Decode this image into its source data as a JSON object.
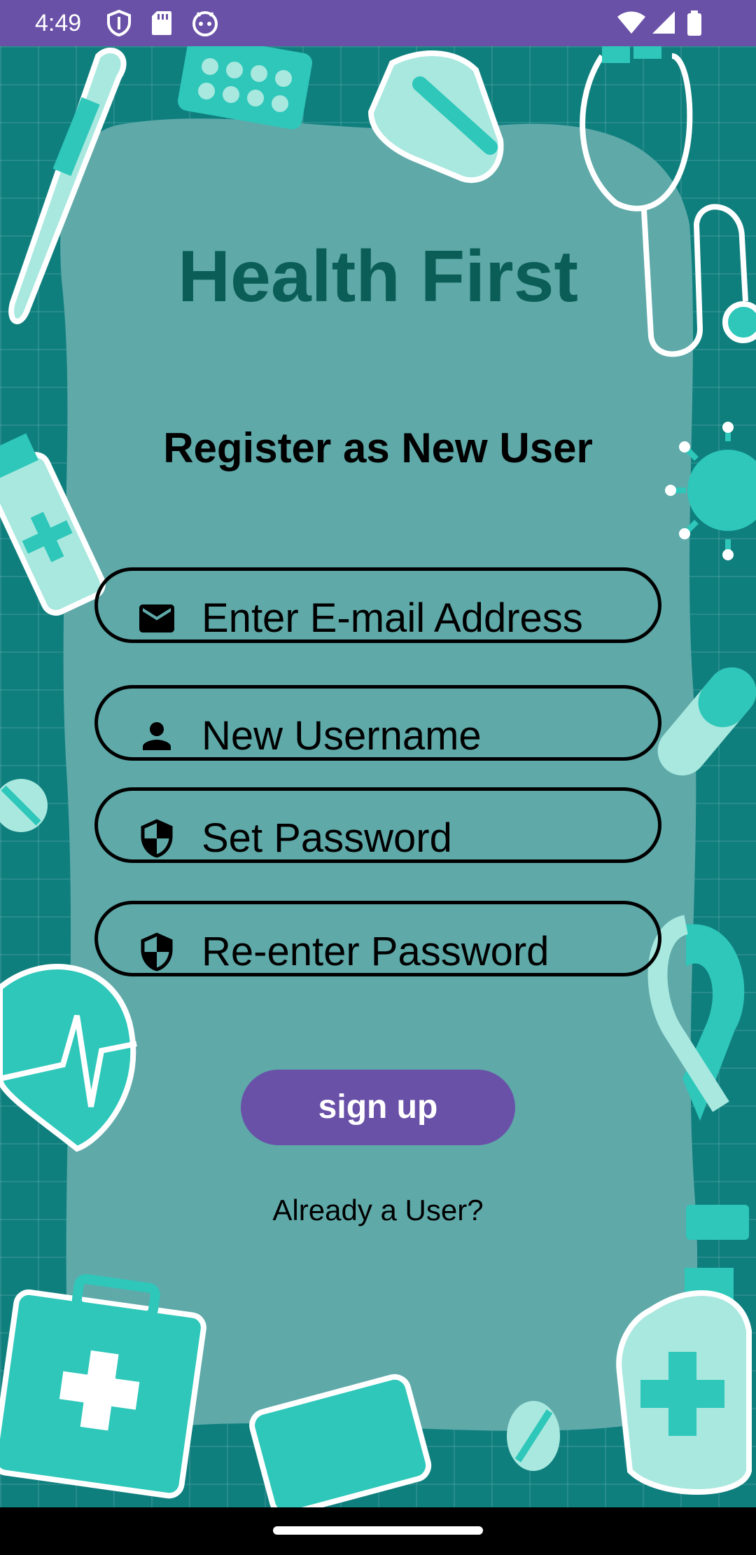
{
  "status_bar": {
    "time": "4:49",
    "left_icons": [
      "shield-icon",
      "sd-card-icon",
      "android-head-icon"
    ],
    "right_icons": [
      "wifi-icon",
      "signal-icon",
      "battery-icon"
    ],
    "color": "#6a51a8"
  },
  "app": {
    "title": "Health First",
    "subtitle": "Register as New User"
  },
  "form": {
    "email_placeholder": "Enter E-mail Address",
    "username_placeholder": "New Username",
    "password_placeholder": "Set Password",
    "confirm_placeholder": "Re-enter Password",
    "signup_label": "sign up",
    "login_link": "Already a User?"
  },
  "colors": {
    "accent": "#6a51a8",
    "title": "#0b5e58",
    "background": "#0f7f7e",
    "panel": "#5fa9a9",
    "decoration": "#2ec7ba"
  }
}
